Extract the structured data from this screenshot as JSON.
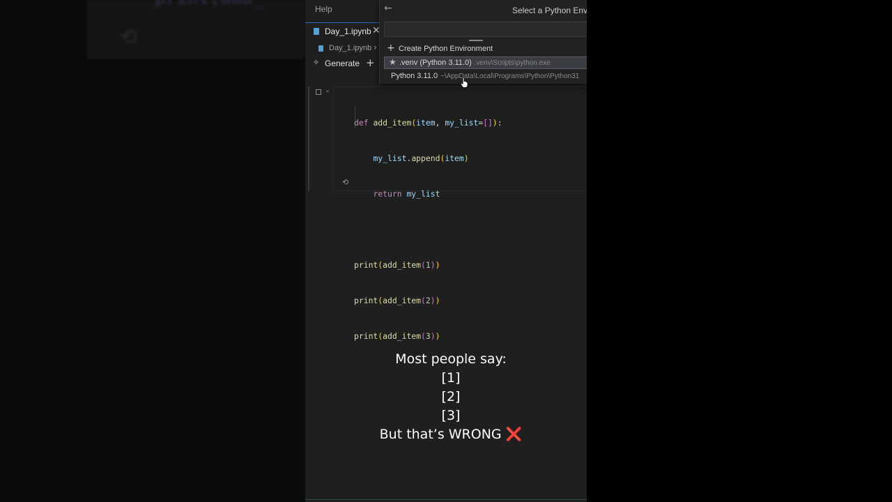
{
  "menu": {
    "help": "Help"
  },
  "tab": {
    "label": "Day_1.ipynb",
    "close": "✕"
  },
  "breadcrumb": {
    "file": "Day_1.ipynb",
    "chevron": "›"
  },
  "toolbar": {
    "generate_label": "Generate",
    "generate_icon": "sparkle-icon",
    "add_icon": "+"
  },
  "quick_pick": {
    "back_icon": "←",
    "title": "Select a Python Enviro",
    "input_value": "",
    "create_label": "Create Python Environment",
    "create_icon": "+",
    "items": [
      {
        "label": ".venv (Python 3.11.0)",
        "description": ".venv\\Scripts\\python.exe",
        "icon": "star-icon",
        "selected": true
      },
      {
        "label": "Python 3.11.0",
        "description": "~\\AppData\\Local\\Programs\\Python\\Python31"
      }
    ]
  },
  "cell": {
    "code_lines": [
      "def add_item(item, my_list=[]):",
      "    my_list.append(item)",
      "    return my_list",
      "",
      "print(add_item(1))",
      "print(add_item(2))",
      "print(add_item(3))"
    ]
  },
  "caption": {
    "line1": "Most people say:",
    "line2": "[1]",
    "line3": "[2]",
    "line4": "[3]",
    "line5": "But that’s WRONG",
    "cross": "❌"
  },
  "background": {
    "ghost_text": "print(add_"
  },
  "colors": {
    "accent": "#2d6ec8",
    "keyword": "#c586c0",
    "function": "#dcdcaa",
    "variable": "#9cdcfe",
    "number": "#b5cea8",
    "wrong_mark": "#e0243d"
  }
}
